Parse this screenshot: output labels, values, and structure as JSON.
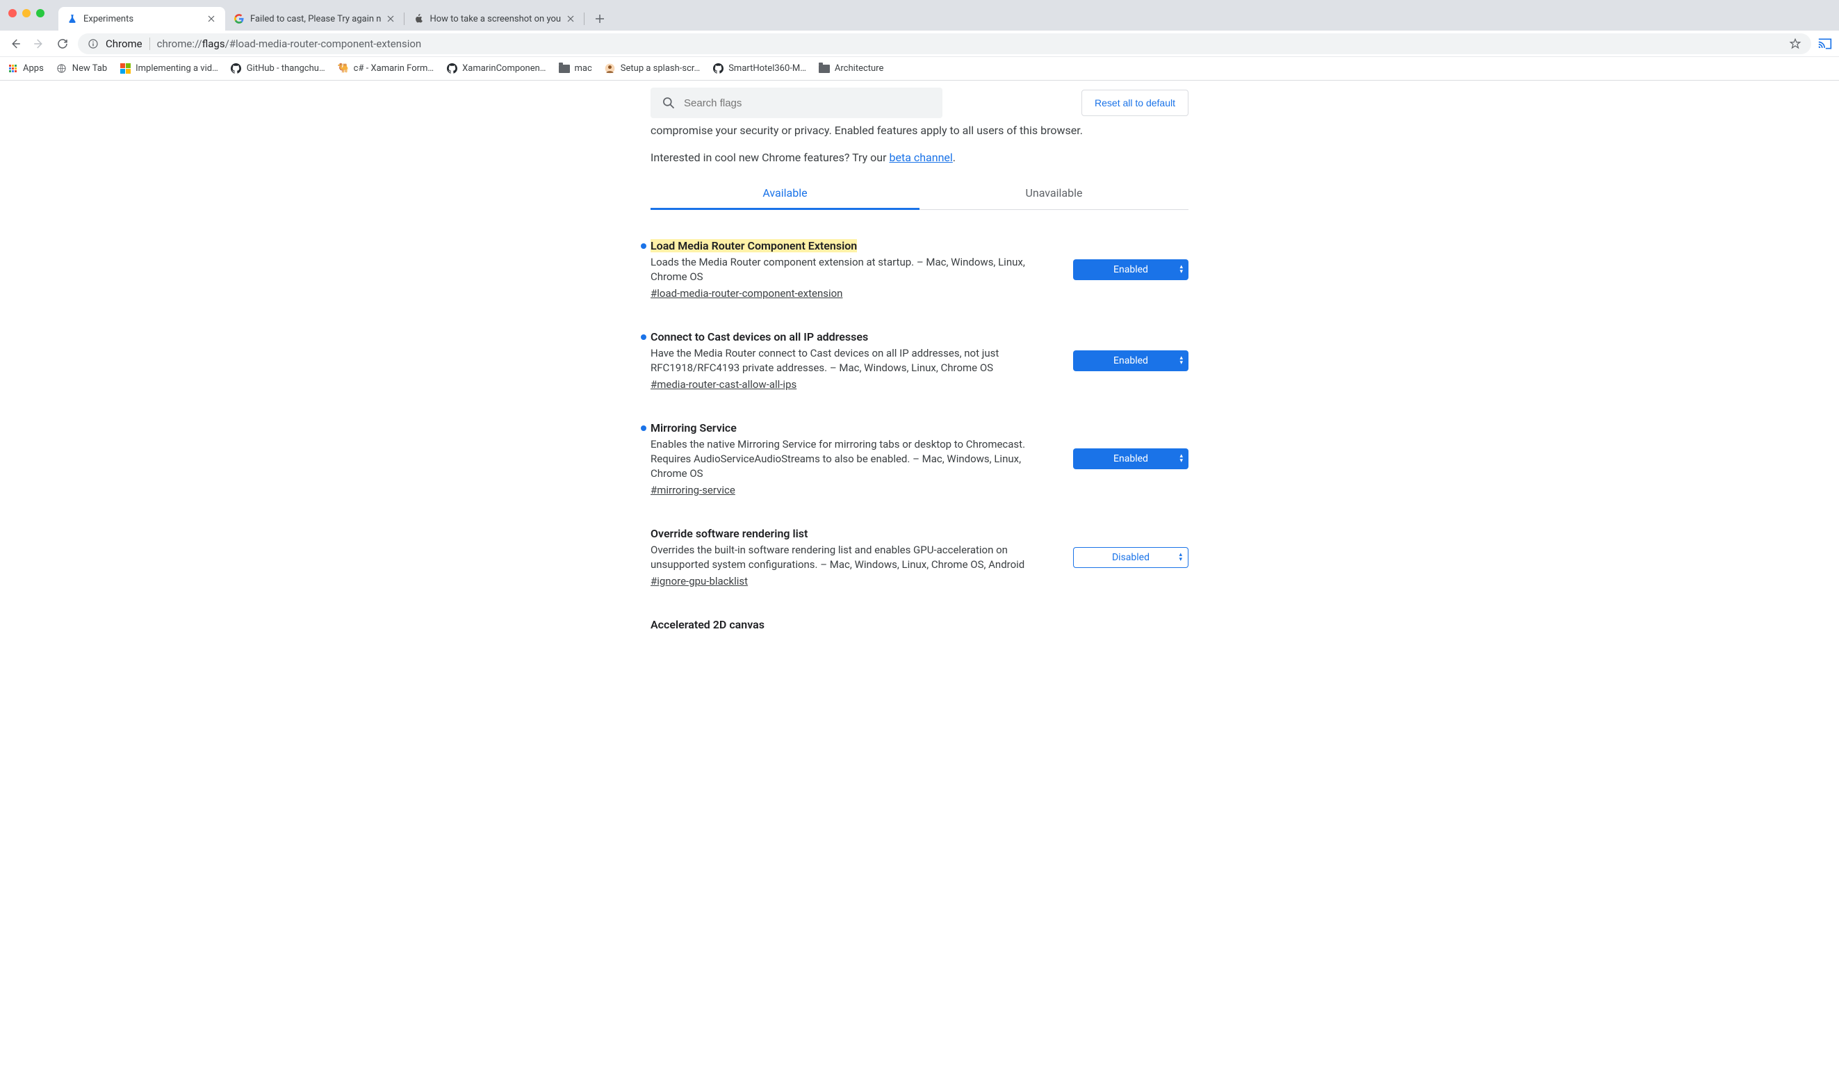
{
  "window": {
    "tabs": [
      {
        "title": "Experiments",
        "active": true,
        "favicon": "flask"
      },
      {
        "title": "Failed to cast, Please Try again n",
        "active": false,
        "favicon": "google"
      },
      {
        "title": "How to take a screenshot on you",
        "active": false,
        "favicon": "apple"
      }
    ]
  },
  "toolbar": {
    "omnibox_label": "Chrome",
    "url_prefix": "chrome://",
    "url_bold": "flags",
    "url_suffix": "/#load-media-router-component-extension"
  },
  "bookmarks": [
    {
      "label": "Apps",
      "icon": "apps"
    },
    {
      "label": "New Tab",
      "icon": "globe"
    },
    {
      "label": "Implementing a vid…",
      "icon": "ms"
    },
    {
      "label": "GitHub - thangchu…",
      "icon": "github"
    },
    {
      "label": "c# - Xamarin Form…",
      "icon": "camel"
    },
    {
      "label": "XamarinComponen…",
      "icon": "github"
    },
    {
      "label": "mac",
      "icon": "folder"
    },
    {
      "label": "Setup a splash-scr…",
      "icon": "avatar"
    },
    {
      "label": "SmartHotel360-M…",
      "icon": "github"
    },
    {
      "label": "Architecture",
      "icon": "folder"
    }
  ],
  "page": {
    "search_placeholder": "Search flags",
    "reset_label": "Reset all to default",
    "warning_fragment": "compromise your security or privacy. Enabled features apply to all users of this browser.",
    "interest_prefix": "Interested in cool new Chrome features? Try our ",
    "interest_link": "beta channel",
    "interest_suffix": ".",
    "tabs": {
      "available": "Available",
      "unavailable": "Unavailable"
    }
  },
  "flags": [
    {
      "title": "Load Media Router Component Extension",
      "highlighted": true,
      "modified": true,
      "desc": "Loads the Media Router component extension at startup. – Mac, Windows, Linux, Chrome OS",
      "anchor": "#load-media-router-component-extension",
      "value": "Enabled",
      "value_style": "enabled"
    },
    {
      "title": "Connect to Cast devices on all IP addresses",
      "highlighted": false,
      "modified": true,
      "desc": "Have the Media Router connect to Cast devices on all IP addresses, not just RFC1918/RFC4193 private addresses. – Mac, Windows, Linux, Chrome OS",
      "anchor": "#media-router-cast-allow-all-ips",
      "value": "Enabled",
      "value_style": "enabled"
    },
    {
      "title": "Mirroring Service",
      "highlighted": false,
      "modified": true,
      "desc": "Enables the native Mirroring Service for mirroring tabs or desktop to Chromecast. Requires AudioServiceAudioStreams to also be enabled. – Mac, Windows, Linux, Chrome OS",
      "anchor": "#mirroring-service",
      "value": "Enabled",
      "value_style": "enabled"
    },
    {
      "title": "Override software rendering list",
      "highlighted": false,
      "modified": false,
      "desc": "Overrides the built-in software rendering list and enables GPU-acceleration on unsupported system configurations. – Mac, Windows, Linux, Chrome OS, Android",
      "anchor": "#ignore-gpu-blacklist",
      "value": "Disabled",
      "value_style": "disabled"
    },
    {
      "title": "Accelerated 2D canvas",
      "highlighted": false,
      "modified": false,
      "desc": "",
      "anchor": "",
      "value": "",
      "value_style": ""
    }
  ]
}
